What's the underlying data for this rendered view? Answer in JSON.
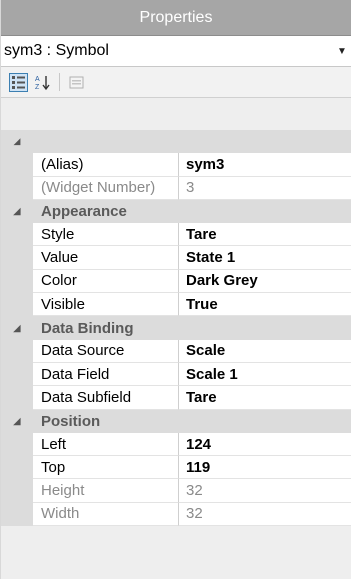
{
  "title": "Properties",
  "selector": {
    "value": "sym3 : Symbol"
  },
  "toolbar": {
    "categorized_icon": "categorized-view-icon",
    "alphabetical_icon": "alphabetical-sort-icon",
    "property_pages_icon": "property-pages-icon"
  },
  "grid": {
    "top_row": {
      "name": "(Alias)",
      "value": "sym3"
    },
    "widget_number": {
      "name": "(Widget Number)",
      "value": "3"
    },
    "appearance": {
      "label": "Appearance",
      "style": {
        "name": "Style",
        "value": "Tare"
      },
      "value": {
        "name": "Value",
        "value": "State 1"
      },
      "color": {
        "name": "Color",
        "value": "Dark Grey"
      },
      "visible": {
        "name": "Visible",
        "value": "True"
      }
    },
    "data_binding": {
      "label": "Data Binding",
      "source": {
        "name": "Data Source",
        "value": "Scale"
      },
      "field": {
        "name": "Data Field",
        "value": "Scale 1"
      },
      "subfield": {
        "name": "Data Subfield",
        "value": "Tare"
      }
    },
    "position": {
      "label": "Position",
      "left": {
        "name": "Left",
        "value": "124"
      },
      "top": {
        "name": "Top",
        "value": "119"
      },
      "height": {
        "name": "Height",
        "value": "32"
      },
      "width": {
        "name": "Width",
        "value": "32"
      }
    }
  },
  "colors": {
    "titlebar": "#a6a6a6",
    "category_bg": "#dcdcdc",
    "selection_border": "#3c7fb1"
  }
}
